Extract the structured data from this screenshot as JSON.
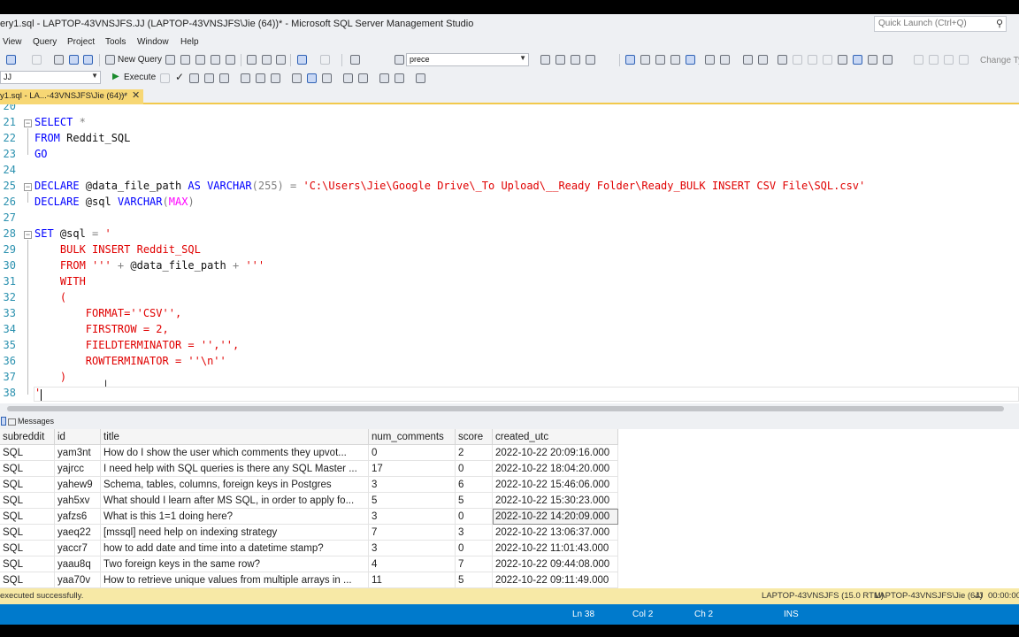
{
  "window": {
    "title": "ery1.sql - LAPTOP-43VNSJFS.JJ (LAPTOP-43VNSJFS\\Jie (64))* - Microsoft SQL Server Management Studio",
    "quick_launch_placeholder": "Quick Launch (Ctrl+Q)"
  },
  "menu": [
    "View",
    "Query",
    "Project",
    "Tools",
    "Window",
    "Help"
  ],
  "toolbar": {
    "new_query": "New Query",
    "search_combo": "prece",
    "change_type": "Change Typ",
    "database_combo": "JJ",
    "execute": "Execute"
  },
  "tab": {
    "label": "y1.sql - LA...-43VNSJFS\\Jie (64))*",
    "pin": "⇾",
    "close": "✕"
  },
  "editor": {
    "line_numbers": [
      "20",
      "21",
      "22",
      "23",
      "24",
      "25",
      "26",
      "27",
      "28",
      "29",
      "30",
      "31",
      "32",
      "33",
      "34",
      "35",
      "36",
      "37",
      "38"
    ],
    "l21_a": "SELECT",
    "l21_b": " *",
    "l22_a": "FROM",
    "l22_b": " Reddit_SQL",
    "l23_a": "GO",
    "l25_a": "DECLARE",
    "l25_b": " @data_file_path ",
    "l25_c": "AS VARCHAR",
    "l25_d": "(255) ",
    "l25_e": "=",
    "l25_f": " 'C:\\Users\\Jie\\Google Drive\\_To Upload\\__Ready Folder\\Ready_BULK INSERT CSV File\\SQL.csv'",
    "l26_a": "DECLARE",
    "l26_b": " @sql ",
    "l26_c": "VARCHAR",
    "l26_d": "(",
    "l26_e": "MAX",
    "l26_f": ")",
    "l28_a": "SET",
    "l28_b": " @sql ",
    "l28_c": "=",
    "l28_d": " '",
    "l29": "    BULK INSERT Reddit_SQL",
    "l30_a": "    FROM '''",
    "l30_b": " + ",
    "l30_c": "@data_file_path",
    "l30_d": " + ",
    "l30_e": "'''",
    "l31": "    WITH",
    "l32": "    (",
    "l33": "        FORMAT=''CSV'',",
    "l34": "        FIRSTROW = 2,",
    "l35": "        FIELDTERMINATOR = '','',",
    "l36": "        ROWTERMINATOR = ''\\n''",
    "l37": "    )",
    "l38": "'"
  },
  "results": {
    "messages_tab": "Messages",
    "columns": [
      "subreddit",
      "id",
      "title",
      "num_comments",
      "score",
      "created_utc"
    ],
    "rows": [
      [
        "SQL",
        "yam3nt",
        "How do I show the user which comments they upvot...",
        "0",
        "2",
        "2022-10-22 20:09:16.000"
      ],
      [
        "SQL",
        "yajrcc",
        "I need help with SQL queries is there any SQL Master ...",
        "17",
        "0",
        "2022-10-22 18:04:20.000"
      ],
      [
        "SQL",
        "yahew9",
        "Schema, tables, columns, foreign keys in Postgres",
        "3",
        "6",
        "2022-10-22 15:46:06.000"
      ],
      [
        "SQL",
        "yah5xv",
        "What should I learn after MS SQL, in order to apply fo...",
        "5",
        "5",
        "2022-10-22 15:30:23.000"
      ],
      [
        "SQL",
        "yafzs6",
        "What is this 1=1 doing here?",
        "3",
        "0",
        "2022-10-22 14:20:09.000"
      ],
      [
        "SQL",
        "yaeq22",
        "[mssql] need help on indexing strategy",
        "7",
        "3",
        "2022-10-22 13:06:37.000"
      ],
      [
        "SQL",
        "yaccr7",
        "how to add date and time into a datetime stamp?",
        "3",
        "0",
        "2022-10-22 11:01:43.000"
      ],
      [
        "SQL",
        "yaau8q",
        "Two foreign keys in the same row?",
        "4",
        "7",
        "2022-10-22 09:44:08.000"
      ],
      [
        "SQL",
        "yaa70v",
        "How to retrieve unique values from multiple arrays in ...",
        "11",
        "5",
        "2022-10-22 09:11:49.000"
      ]
    ]
  },
  "status": {
    "message": "executed successfully.",
    "server": "LAPTOP-43VNSJFS (15.0 RTM)",
    "user": "LAPTOP-43VNSJFS\\Jie (64)",
    "db": "JJ",
    "time": "00:00:00",
    "ln": "Ln 38",
    "col": "Col 2",
    "ch": "Ch 2",
    "ins": "INS"
  },
  "colors": {
    "tab_active": "#f7d774",
    "status_bar": "#007acc",
    "keyword": "#0000ff",
    "string": "#e00000",
    "line_number": "#2b91af"
  }
}
